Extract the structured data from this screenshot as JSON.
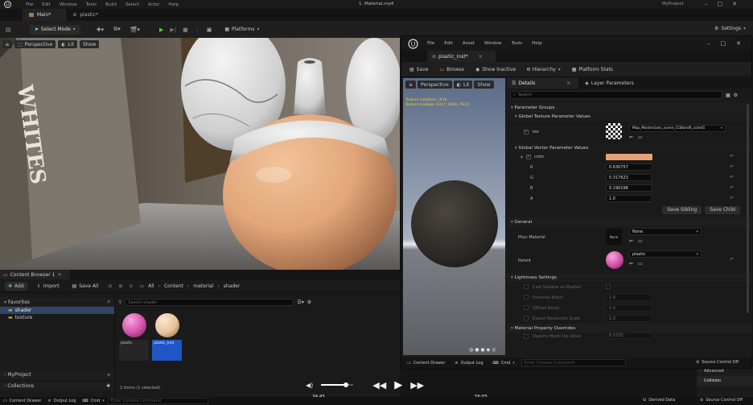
{
  "menu": {
    "items": [
      "File",
      "Edit",
      "Window",
      "Tools",
      "Build",
      "Select",
      "Actor",
      "Help"
    ],
    "doc_title": "1. Material.mp4",
    "project": "MyProject"
  },
  "tabs": {
    "main": "Main*",
    "plastic": "plastic*"
  },
  "toolbar": {
    "select_mode": "Select Mode",
    "platforms": "Platforms",
    "settings": "Settings"
  },
  "viewport": {
    "perspective": "Perspective",
    "lit": "Lit",
    "show": "Show"
  },
  "content_browser": {
    "title": "Content Browser 1",
    "add": "Add",
    "import": "Import",
    "save_all": "Save All",
    "breadcrumb": [
      "All",
      "Content",
      "material",
      "shader"
    ],
    "favorites": "Favorites",
    "folders": [
      "shader",
      "texture"
    ],
    "search_placeholder": "Search shader",
    "assets": [
      {
        "name": "plastic",
        "color": "#d14fa8"
      },
      {
        "name": "plastic_Inst",
        "color": "#e6c29a"
      }
    ],
    "status": "2 items (1 selected)",
    "myproject": "MyProject",
    "collections": "Collections"
  },
  "bottom_left": {
    "content_drawer": "Content Drawer",
    "output_log": "Output Log",
    "cmd": "Cmd",
    "console_placeholder": "Enter Console Command"
  },
  "video": {
    "time_current": "34:45",
    "time_total": "56:05",
    "progress": 0.52
  },
  "editor": {
    "menu": [
      "File",
      "Edit",
      "Asset",
      "Window",
      "Tools",
      "Help"
    ],
    "tab": "plastic_Inst*",
    "toolbar": {
      "save": "Save",
      "browse": "Browse",
      "show_inactive": "Show Inactive",
      "hierarchy": "Hierarchy",
      "platform_stats": "Platform Stats"
    },
    "viewport": {
      "perspective": "Perspective",
      "lit": "Lit",
      "show": "Show",
      "stat1": "Texture samplers: 3/16",
      "stat2": "Texture Lookups (Est.): VS(0), PS(1)"
    },
    "details_tab": "Details",
    "layer_tab": "Layer Parameters",
    "search_placeholder": "Search"
  },
  "params": {
    "groups": "Parameter Groups",
    "texture_group": "Global Texture Parameter Values",
    "tex_label": "tex",
    "tex_value": "Map_Masterclass_scene_CGBandit_comd1",
    "vector_group": "Global Vector Parameter Values",
    "color_label": "color",
    "swatch": "#e6a076",
    "channels": [
      {
        "k": "R",
        "v": "0.630757"
      },
      {
        "k": "G",
        "v": "0.317623"
      },
      {
        "k": "B",
        "v": "0.190198"
      },
      {
        "k": "A",
        "v": "1.0"
      }
    ],
    "save_sibling": "Save Sibling",
    "save_child": "Save Child",
    "general": "General",
    "phys_material": "Phys Material",
    "phys_thumb": "None",
    "phys_value": "None",
    "parent": "Parent",
    "parent_value": "plastic",
    "lightmass": "Lightmass Settings",
    "lightmass_rows": [
      {
        "k": "Cast Shadow as Masked",
        "v": ""
      },
      {
        "k": "Emissive Boost",
        "v": "1.0"
      },
      {
        "k": "Diffuse Boost",
        "v": "1.0"
      },
      {
        "k": "Export Resolution Scale",
        "v": "1.0"
      }
    ],
    "overrides": "Material Property Overrides",
    "opacity": "Opacity Mask Clip Value",
    "opacity_value": "0.3333"
  },
  "editor_bottom": {
    "content_drawer": "Content Drawer",
    "output_log": "Output Log",
    "cmd": "Cmd",
    "console_placeholder": "Enter Console Command",
    "source_control": "Source Control Off"
  },
  "far_right": {
    "advanced": "Advanced",
    "collision": "Collision"
  },
  "status_bar": {
    "content_drawer": "Content Drawer",
    "output_log": "Output Log",
    "cmd": "Cmd",
    "console_placeholder": "Enter Console Command",
    "derived_data": "Derived Data",
    "source_control": "Source Control Off"
  }
}
